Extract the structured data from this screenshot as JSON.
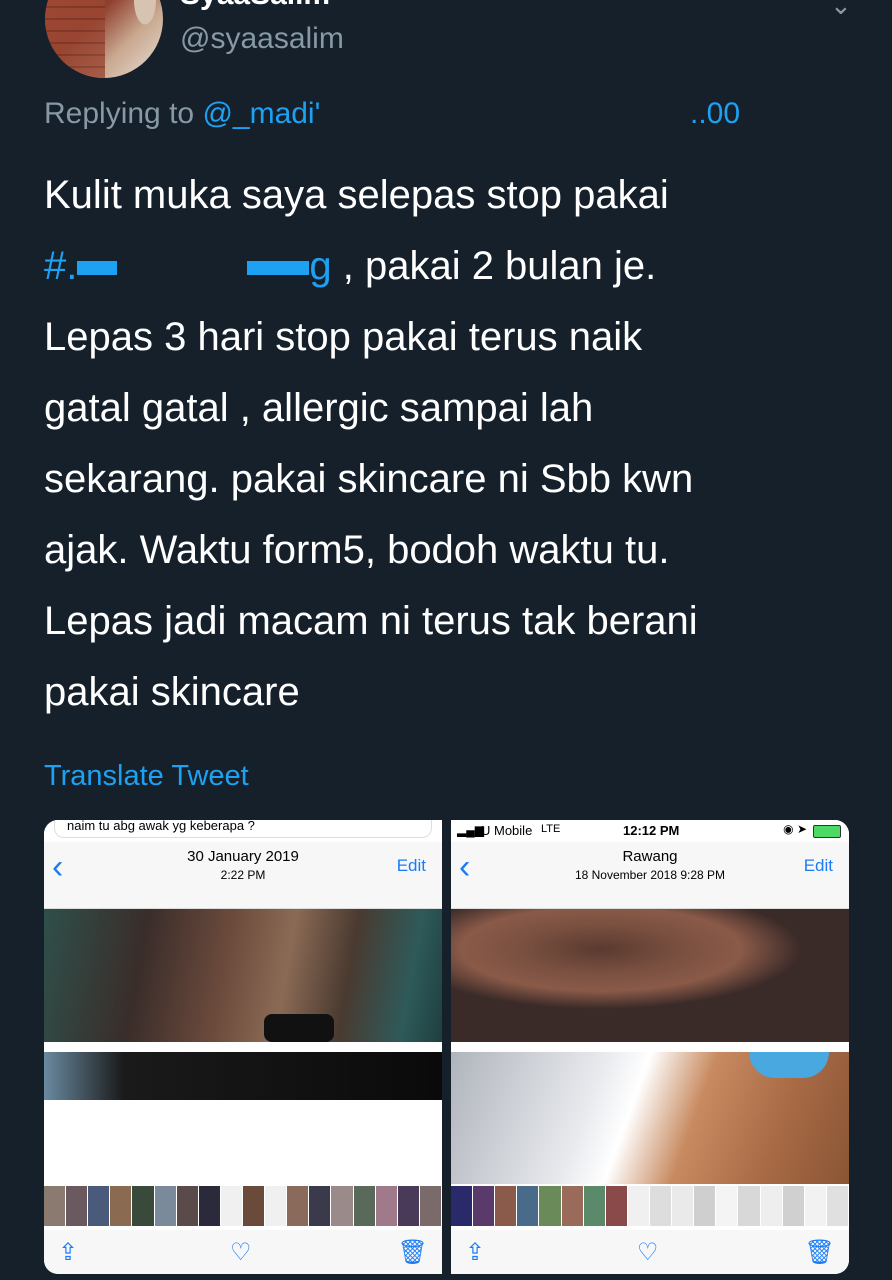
{
  "user": {
    "display_name": "SyaaSalim",
    "handle": "@syaasalim"
  },
  "reply": {
    "prefix": "Replying to ",
    "mention": "@_madi'",
    "tail": "..00"
  },
  "tweet": {
    "line1": "Kulit muka saya selepas stop pakai",
    "line2_hash_start": "#.",
    "line2_hash_end": "g",
    "line2_rest": " , pakai 2 bulan je.",
    "line3": "Lepas 3 hari stop pakai terus naik",
    "line4": "gatal gatal , allergic sampai lah",
    "line5": "sekarang. pakai skincare ni Sbb kwn",
    "line6": "ajak. Waktu form5, bodoh waktu tu.",
    "line7": "Lepas jadi macam ni terus tak berani",
    "line8": "pakai skincare"
  },
  "translate_label": "Translate Tweet",
  "media": {
    "left": {
      "top_message": "naim  tu abg awak yg keberapa ?",
      "date": "30 January 2019",
      "time": "2:22 PM",
      "edit": "Edit"
    },
    "right": {
      "carrier": "U Mobile",
      "network": "LTE",
      "clock": "12:12 PM",
      "location": "Rawang",
      "date_time": "18 November 2018  9:28 PM",
      "edit": "Edit"
    }
  },
  "icons": {
    "back": "chevron-left-icon",
    "share": "share-icon",
    "favorite": "heart-icon",
    "delete": "trash-icon",
    "more": "more-icon"
  },
  "colors": {
    "background": "#15202b",
    "link": "#1da1f2",
    "secondary_text": "#8899a6",
    "ios_blue": "#1a7cf5"
  }
}
